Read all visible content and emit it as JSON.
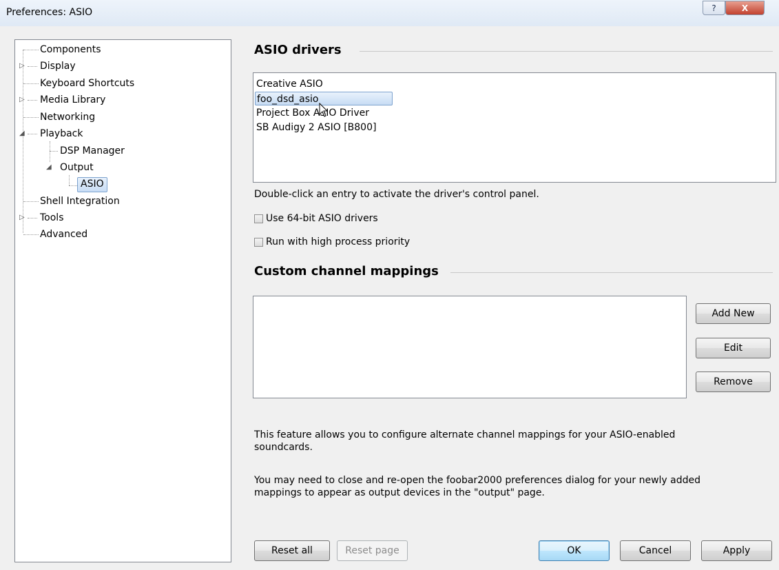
{
  "window": {
    "title": "Preferences: ASIO",
    "help_glyph": "?",
    "close_glyph": "X"
  },
  "tree": {
    "items": [
      {
        "label": "Components",
        "expander": ""
      },
      {
        "label": "Display",
        "expander": "▷"
      },
      {
        "label": "Keyboard Shortcuts",
        "expander": ""
      },
      {
        "label": "Media Library",
        "expander": "▷"
      },
      {
        "label": "Networking",
        "expander": ""
      },
      {
        "label": "Playback",
        "expander": "◢"
      },
      {
        "label": "DSP Manager",
        "expander": ""
      },
      {
        "label": "Output",
        "expander": "◢"
      },
      {
        "label": "ASIO",
        "expander": "",
        "selected": true
      },
      {
        "label": "Shell Integration",
        "expander": ""
      },
      {
        "label": "Tools",
        "expander": "▷"
      },
      {
        "label": "Advanced",
        "expander": ""
      }
    ]
  },
  "asio": {
    "section_title": "ASIO drivers",
    "drivers": [
      "Creative ASIO",
      "foo_dsd_asio",
      "Project Box ASIO Driver",
      "SB Audigy 2 ASIO [B800]"
    ],
    "selected_driver": "foo_dsd_asio",
    "hint": "Double-click an entry to activate the driver's control panel.",
    "checkbox_64bit": {
      "label": "Use 64-bit ASIO drivers",
      "checked": false
    },
    "checkbox_priority": {
      "label": "Run with high process priority",
      "checked": false
    }
  },
  "mappings": {
    "section_title": "Custom channel mappings",
    "add_new_label": "Add New",
    "edit_label": "Edit",
    "remove_label": "Remove",
    "desc1": "This feature allows you to configure alternate channel mappings for your ASIO-enabled soundcards.",
    "desc2": "You may need to close and re-open the foobar2000 preferences dialog for your newly added mappings to appear as output devices in the \"output\" page."
  },
  "footer": {
    "reset_all_label": "Reset all",
    "reset_page_label": "Reset page",
    "ok_label": "OK",
    "cancel_label": "Cancel",
    "apply_label": "Apply"
  },
  "colors": {
    "accent": "#3c7fb1",
    "selection": "#c8ddf5",
    "close": "#c2412e"
  }
}
